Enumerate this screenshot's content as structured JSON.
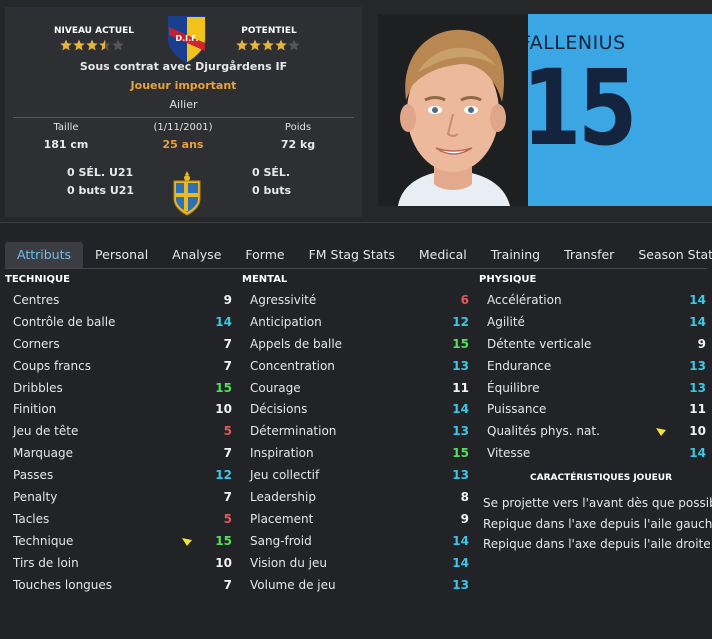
{
  "header": {
    "current_level_label": "NIVEAU ACTUEL",
    "current_level_stars": 3.5,
    "potential_label": "POTENTIEL",
    "potential_stars": 4,
    "club_crest_text": "D.I.F.",
    "contract": "Sous contrat avec Djurgårdens IF",
    "role": "Joueur important",
    "position": "Ailier",
    "height_label": "Taille",
    "height_value": "181 cm",
    "dob": "(1/11/2001)",
    "age": "25 ans",
    "weight_label": "Poids",
    "weight_value": "72 kg",
    "u21_caps": "0 SÉL. U21",
    "u21_goals": "0 buts U21",
    "caps": "0 SÉL.",
    "goals": "0 buts",
    "shirt_name": "FALLENIUS",
    "shirt_number": "15"
  },
  "tabs": [
    {
      "label": "Attributs",
      "active": true
    },
    {
      "label": "Personal",
      "active": false
    },
    {
      "label": "Analyse",
      "active": false
    },
    {
      "label": "Forme",
      "active": false
    },
    {
      "label": "FM Stag Stats",
      "active": false
    },
    {
      "label": "Medical",
      "active": false
    },
    {
      "label": "Training",
      "active": false
    },
    {
      "label": "Transfer",
      "active": false
    },
    {
      "label": "Season Stats",
      "active": false
    }
  ],
  "colors": {
    "red": "#e05a5a",
    "white": "#f2f2f2",
    "cyan": "#3fc6e6",
    "green": "#56e05a",
    "gold": "#e9a23b",
    "shirt": "#3aa7e4",
    "arrow": "#f2e23a"
  },
  "technique": {
    "title": "TECHNIQUE",
    "items": [
      {
        "name": "Centres",
        "value": 9,
        "color": "white"
      },
      {
        "name": "Contrôle de balle",
        "value": 14,
        "color": "cyan"
      },
      {
        "name": "Corners",
        "value": 7,
        "color": "white"
      },
      {
        "name": "Coups francs",
        "value": 7,
        "color": "white"
      },
      {
        "name": "Dribbles",
        "value": 15,
        "color": "green"
      },
      {
        "name": "Finition",
        "value": 10,
        "color": "white"
      },
      {
        "name": "Jeu de tête",
        "value": 5,
        "color": "red"
      },
      {
        "name": "Marquage",
        "value": 7,
        "color": "white"
      },
      {
        "name": "Passes",
        "value": 12,
        "color": "cyan"
      },
      {
        "name": "Penalty",
        "value": 7,
        "color": "white"
      },
      {
        "name": "Tacles",
        "value": 5,
        "color": "red"
      },
      {
        "name": "Technique",
        "value": 15,
        "color": "green",
        "arrow": true
      },
      {
        "name": "Tirs de loin",
        "value": 10,
        "color": "white"
      },
      {
        "name": "Touches longues",
        "value": 7,
        "color": "white"
      }
    ]
  },
  "mental": {
    "title": "MENTAL",
    "items": [
      {
        "name": "Agressivité",
        "value": 6,
        "color": "red"
      },
      {
        "name": "Anticipation",
        "value": 12,
        "color": "cyan"
      },
      {
        "name": "Appels de balle",
        "value": 15,
        "color": "green"
      },
      {
        "name": "Concentration",
        "value": 13,
        "color": "cyan"
      },
      {
        "name": "Courage",
        "value": 11,
        "color": "white"
      },
      {
        "name": "Décisions",
        "value": 14,
        "color": "cyan"
      },
      {
        "name": "Détermination",
        "value": 13,
        "color": "cyan"
      },
      {
        "name": "Inspiration",
        "value": 15,
        "color": "green"
      },
      {
        "name": "Jeu collectif",
        "value": 13,
        "color": "cyan"
      },
      {
        "name": "Leadership",
        "value": 8,
        "color": "white"
      },
      {
        "name": "Placement",
        "value": 9,
        "color": "white"
      },
      {
        "name": "Sang-froid",
        "value": 14,
        "color": "cyan"
      },
      {
        "name": "Vision du jeu",
        "value": 14,
        "color": "cyan"
      },
      {
        "name": "Volume de jeu",
        "value": 13,
        "color": "cyan"
      }
    ]
  },
  "physique": {
    "title": "PHYSIQUE",
    "items": [
      {
        "name": "Accélération",
        "value": 14,
        "color": "cyan"
      },
      {
        "name": "Agilité",
        "value": 14,
        "color": "cyan"
      },
      {
        "name": "Détente verticale",
        "value": 9,
        "color": "white"
      },
      {
        "name": "Endurance",
        "value": 13,
        "color": "cyan"
      },
      {
        "name": "Équilibre",
        "value": 13,
        "color": "cyan"
      },
      {
        "name": "Puissance",
        "value": 11,
        "color": "white"
      },
      {
        "name": "Qualités phys. nat.",
        "value": 10,
        "color": "white",
        "arrow": true
      },
      {
        "name": "Vitesse",
        "value": 14,
        "color": "cyan"
      }
    ]
  },
  "traits": {
    "title": "CARACTÉRISTIQUES JOUEUR",
    "items": [
      "Se projette vers l'avant dès que possible",
      "Repique dans l'axe depuis l'aile gauche",
      "Repique dans l'axe depuis l'aile droite"
    ]
  }
}
